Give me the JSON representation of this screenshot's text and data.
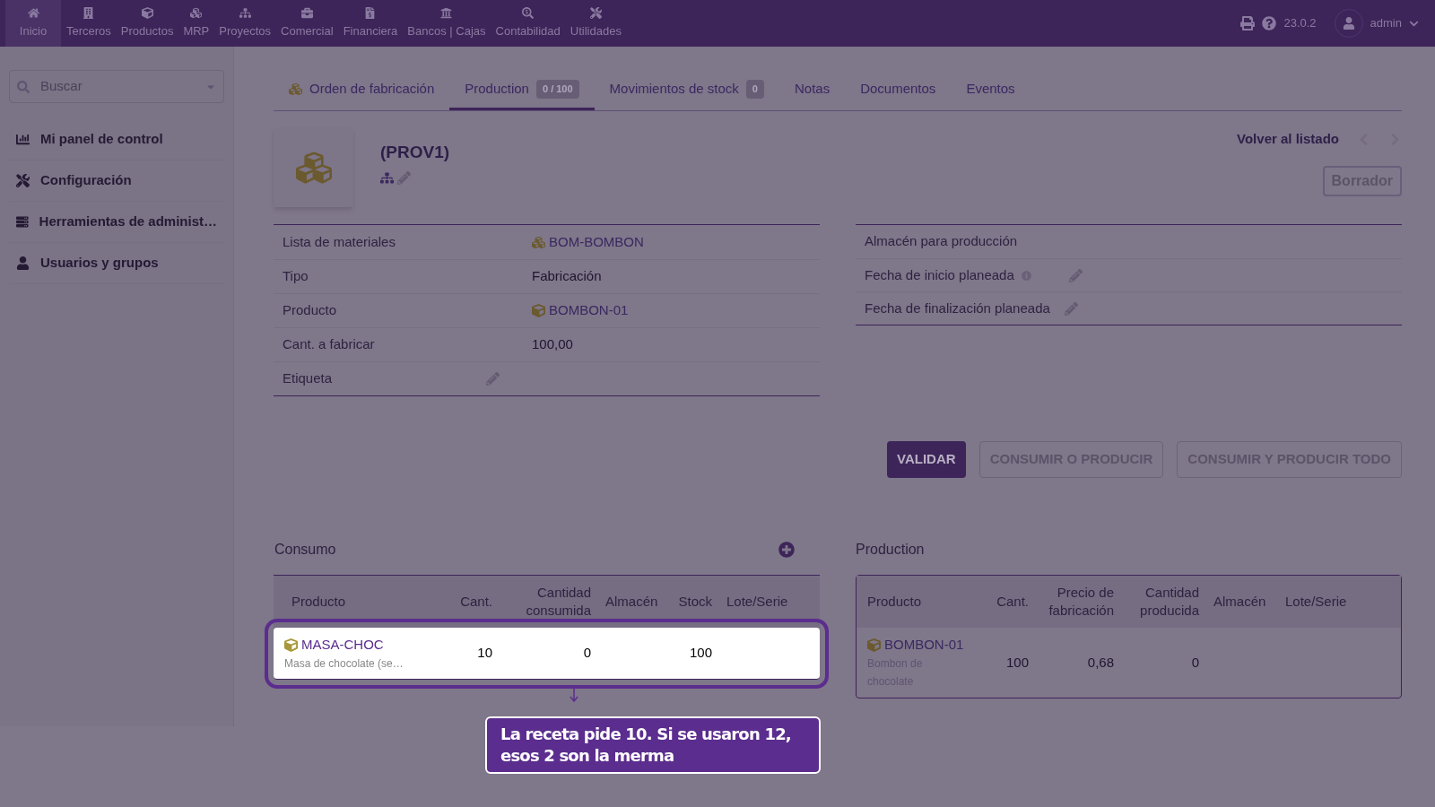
{
  "top_menu": {
    "items": [
      {
        "label": "Inicio",
        "selected": true
      },
      {
        "label": "Terceros",
        "selected": false
      },
      {
        "label": "Productos",
        "selected": false
      },
      {
        "label": "MRP",
        "selected": false
      },
      {
        "label": "Proyectos",
        "selected": false
      },
      {
        "label": "Comercial",
        "selected": false
      },
      {
        "label": "Financiera",
        "selected": false
      },
      {
        "label": "Bancos | Cajas",
        "selected": false
      },
      {
        "label": "Contabilidad",
        "selected": false
      },
      {
        "label": "Utilidades",
        "selected": false
      }
    ],
    "version": "23.0.2",
    "user": "admin"
  },
  "sidebar": {
    "search_placeholder": "Buscar",
    "items": [
      {
        "label": "Mi panel de control"
      },
      {
        "label": "Configuración"
      },
      {
        "label": "Herramientas de administ…"
      },
      {
        "label": "Usuarios y grupos"
      }
    ]
  },
  "tabs": [
    {
      "label": "Orden de fabricación",
      "selected": false
    },
    {
      "label": "Production",
      "badge": "0 / 100",
      "selected": true
    },
    {
      "label": "Movimientos de stock",
      "badge": "0",
      "selected": false
    },
    {
      "label": "Notas",
      "selected": false
    },
    {
      "label": "Documentos",
      "selected": false
    },
    {
      "label": "Eventos",
      "selected": false
    }
  ],
  "header": {
    "ref": "(PROV1)",
    "back_link": "Volver al listado",
    "status": "Borrador"
  },
  "left_fields": [
    {
      "label": "Lista de materiales",
      "value": "BOM-BOMBON",
      "kind": "bom"
    },
    {
      "label": "Tipo",
      "value": "Fabricación",
      "kind": "text"
    },
    {
      "label": "Producto",
      "value": "BOMBON-01",
      "kind": "product"
    },
    {
      "label": "Cant. a fabricar",
      "value": "100,00",
      "kind": "text"
    },
    {
      "label": "Etiqueta",
      "kind": "editable"
    }
  ],
  "right_fields": [
    {
      "label": "Almacén para producción",
      "info": false,
      "editable": false
    },
    {
      "label": "Fecha de inicio planeada",
      "info": true,
      "editable": true
    },
    {
      "label": "Fecha de finalización planeada",
      "info": false,
      "editable": true
    }
  ],
  "buttons": [
    {
      "label": "VALIDAR",
      "primary": true
    },
    {
      "label": "CONSUMIR O PRODUCIR",
      "primary": false
    },
    {
      "label": "CONSUMIR Y PRODUCIR TODO",
      "primary": false
    }
  ],
  "consumption": {
    "title": "Consumo",
    "columns": [
      "Producto",
      "Cant.",
      "Cantidad consumida",
      "Almacén",
      "Stock",
      "Lote/Serie"
    ],
    "rows": [
      {
        "product": "MASA-CHOC",
        "description": "Masa de chocolate (se…",
        "qty": "10",
        "consumed": "0",
        "stock": "100",
        "highlighted": true
      }
    ]
  },
  "production": {
    "title": "Production",
    "columns": [
      "Producto",
      "Cant.",
      "Precio de fabricación",
      "Cantidad producida",
      "Almacén",
      "Lote/Serie"
    ],
    "rows": [
      {
        "product": "BOMBON-01",
        "description": "Bombon de chocolate",
        "qty": "100",
        "price": "0,68",
        "produced": "0"
      }
    ]
  },
  "callout": {
    "text": "La receta pide 10. Si se usaron 12, esos 2 son la merma"
  }
}
